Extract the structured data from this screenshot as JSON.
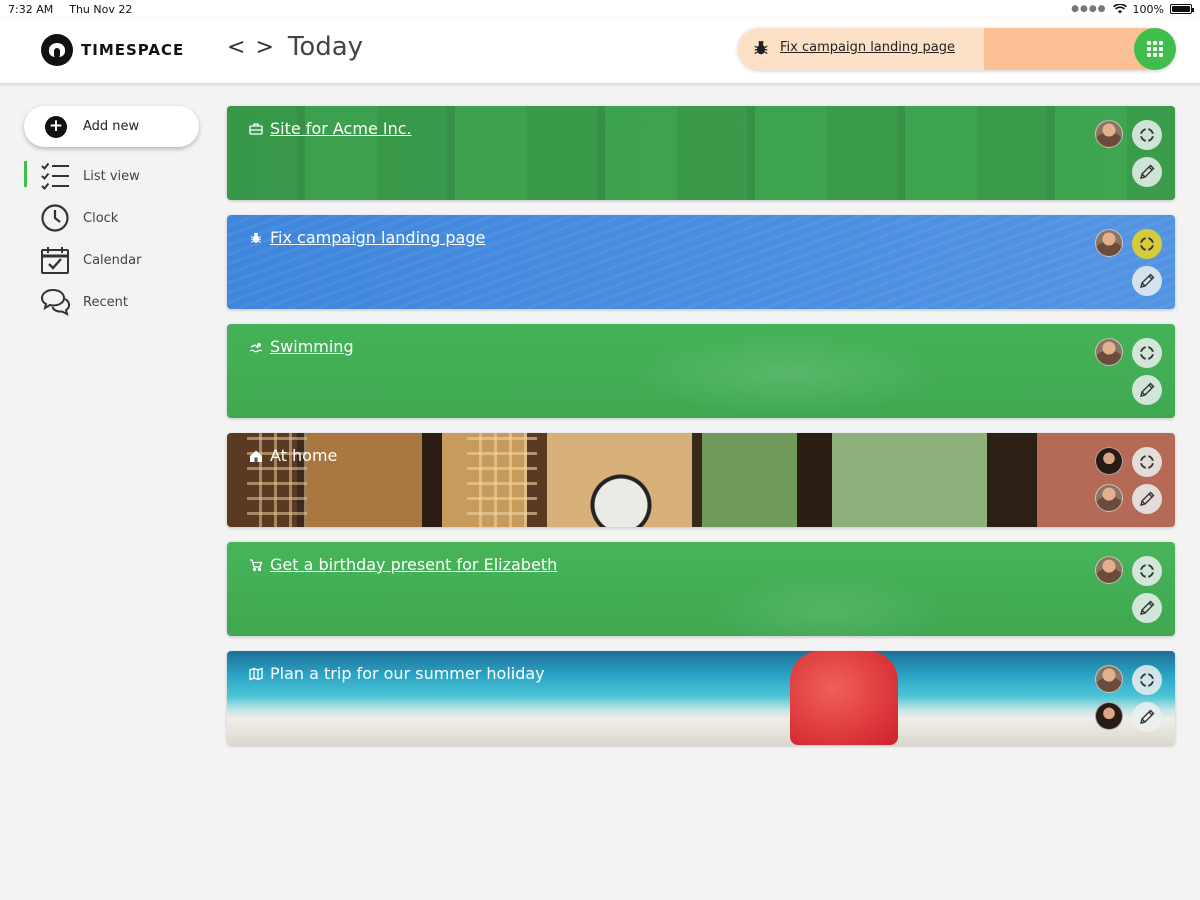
{
  "status_bar": {
    "time": "7:32 AM",
    "date": "Thu Nov 22",
    "battery": "100%"
  },
  "header": {
    "logo_text": "TIMESPACE",
    "prev_icon": "chevron-left-icon",
    "next_icon": "chevron-right-icon",
    "prev_label": "<",
    "next_label": ">",
    "title": "Today",
    "active_timer": {
      "label": "Fix campaign landing page",
      "icon": "bug-icon",
      "bg_color": "#fde1c6",
      "progress_color": "#fbc094"
    },
    "menu_icon": "grid-menu-icon",
    "menu_color": "#3fbe4b"
  },
  "sidebar": {
    "add_new": "Add new",
    "items": [
      {
        "label": "List view",
        "icon": "list-view-icon",
        "active": true
      },
      {
        "label": "Clock",
        "icon": "clock-icon",
        "active": false
      },
      {
        "label": "Calendar",
        "icon": "calendar-icon",
        "active": false
      },
      {
        "label": "Recent",
        "icon": "chat-bubbles-icon",
        "active": false
      }
    ]
  },
  "tasks": [
    {
      "title": "Site for Acme Inc.",
      "icon": "briefcase-icon",
      "style": "green",
      "underlined": true,
      "avatars": [
        "male"
      ]
    },
    {
      "title": "Fix campaign landing page",
      "icon": "bug-icon",
      "style": "blue",
      "underlined": true,
      "avatars": [
        "male"
      ],
      "timer_active": true
    },
    {
      "title": "Swimming",
      "icon": "swimmer-icon",
      "style": "green",
      "underlined": true,
      "avatars": [
        "male"
      ]
    },
    {
      "title": "At home",
      "icon": "home-icon",
      "style": "photo-home",
      "underlined": false,
      "avatars": [
        "female",
        "male"
      ]
    },
    {
      "title": "Get a birthday present for Elizabeth",
      "icon": "cart-icon",
      "style": "green",
      "underlined": true,
      "avatars": [
        "male"
      ]
    },
    {
      "title": "Plan a trip for our summer holiday",
      "icon": "map-icon",
      "style": "photo-beach",
      "underlined": false,
      "avatars": [
        "male",
        "female"
      ]
    }
  ],
  "colors": {
    "accent": "#3fbe4b",
    "task_green": "#43b156",
    "task_blue": "#3f82d8",
    "active_timer_button": "#d6cc3a"
  }
}
